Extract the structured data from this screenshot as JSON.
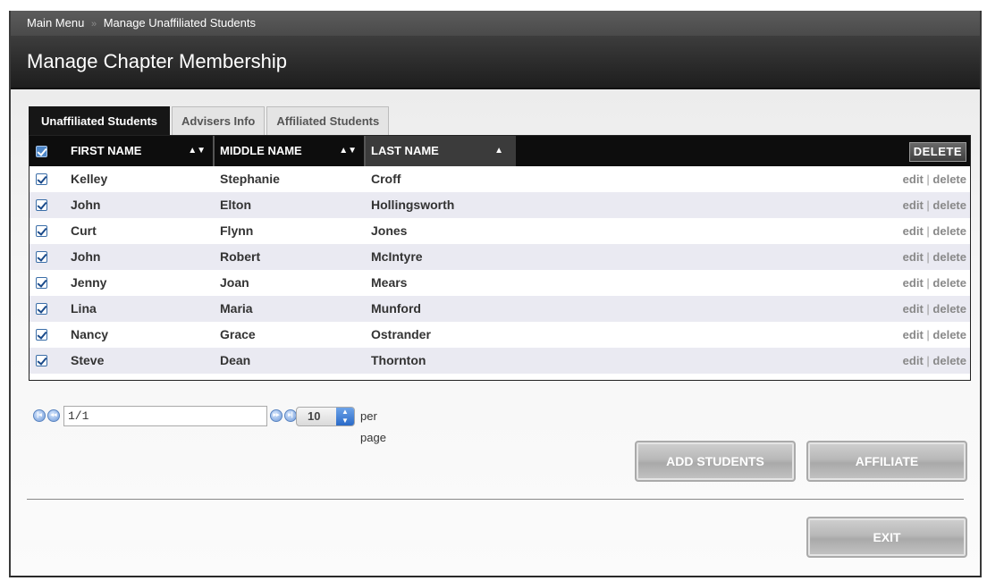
{
  "breadcrumb": {
    "home": "Main Menu",
    "separator": "»",
    "current": "Manage Unaffiliated Students"
  },
  "page_title": "Manage Chapter Membership",
  "tabs": [
    {
      "label": "Unaffiliated Students",
      "active": true
    },
    {
      "label": "Advisers Info",
      "active": false
    },
    {
      "label": "Affiliated Students",
      "active": false
    }
  ],
  "table": {
    "columns": [
      {
        "label": "FIRST NAME",
        "sort_icon": "sort-both-icon"
      },
      {
        "label": "MIDDLE NAME",
        "sort_icon": "sort-both-icon"
      },
      {
        "label": "LAST NAME",
        "sort_icon": "sort-asc-icon",
        "sorted": true
      }
    ],
    "delete_label": "DELETE",
    "action_edit": "edit",
    "action_sep": "|",
    "action_delete": "delete",
    "rows": [
      {
        "first": "Kelley",
        "middle": "Stephanie",
        "last": "Croff",
        "checked": true
      },
      {
        "first": "John",
        "middle": "Elton",
        "last": "Hollingsworth",
        "checked": true
      },
      {
        "first": "Curt",
        "middle": "Flynn",
        "last": "Jones",
        "checked": true
      },
      {
        "first": "John",
        "middle": "Robert",
        "last": "McIntyre",
        "checked": true
      },
      {
        "first": "Jenny",
        "middle": "Joan",
        "last": "Mears",
        "checked": true
      },
      {
        "first": "Lina",
        "middle": "Maria",
        "last": "Munford",
        "checked": true
      },
      {
        "first": "Nancy",
        "middle": "Grace",
        "last": "Ostrander",
        "checked": true
      },
      {
        "first": "Steve",
        "middle": "Dean",
        "last": "Thornton",
        "checked": true
      }
    ]
  },
  "pager": {
    "page_value": "1/1",
    "per_page_value": "10",
    "per_page_label": "per page"
  },
  "buttons": {
    "add_students": "ADD STUDENTS",
    "affiliate": "AFFILIATE",
    "exit": "EXIT"
  },
  "colors": {
    "header_bg": "#0d0d0d",
    "alt_row": "#eaeaf2",
    "accent_blue": "#4d86c7"
  }
}
